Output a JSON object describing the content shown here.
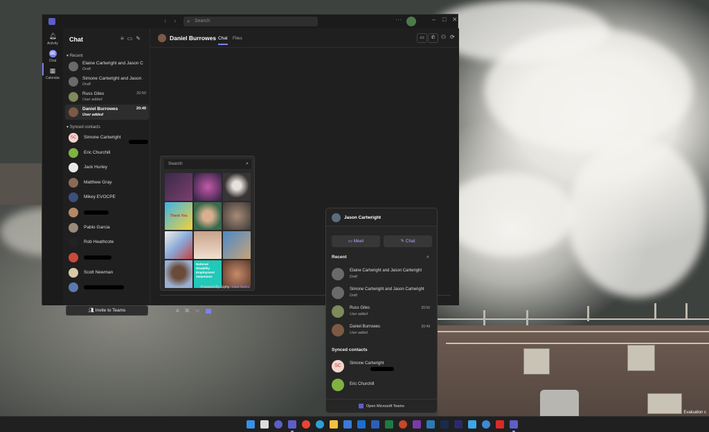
{
  "titlebar": {
    "search_placeholder": "Search",
    "more_icon": "ellipsis-icon"
  },
  "rail": {
    "items": [
      {
        "label": "Activity",
        "icon": "bell-icon"
      },
      {
        "label": "Chat",
        "icon": "chat-icon"
      },
      {
        "label": "Calendar",
        "icon": "calendar-icon"
      }
    ],
    "accent": "#7b83eb"
  },
  "chat_list": {
    "title": "Chat",
    "recent_label": "Recent",
    "recent": [
      {
        "name": "Elaine Cartwright and Jason C...",
        "sub": "Draft",
        "time": ""
      },
      {
        "name": "Simone Cartwright and Jason ...",
        "sub": "Draft",
        "time": ""
      },
      {
        "name": "Russ Giles",
        "sub": "User added",
        "time": "20:50"
      },
      {
        "name": "Daniel Burrowes",
        "sub": "User added",
        "time": "20:49"
      }
    ],
    "synced_label": "Synced contacts",
    "contacts": [
      {
        "name": "Simone Cartwright",
        "initials": "SC"
      },
      {
        "name": "Eric Churchill",
        "initials": ""
      },
      {
        "name": "Jack Hurley",
        "initials": ""
      },
      {
        "name": "Matthew Gray",
        "initials": ""
      },
      {
        "name": "Mikey EVOCPE",
        "initials": ""
      },
      {
        "name": "",
        "initials": ""
      },
      {
        "name": "Pablo Garcia",
        "initials": ""
      },
      {
        "name": "Rob Heathcote",
        "initials": ""
      },
      {
        "name": "",
        "initials": ""
      },
      {
        "name": "Scott Newman",
        "initials": ""
      },
      {
        "name": "",
        "initials": ""
      }
    ],
    "invite_label": "Invite to Teams"
  },
  "conversation": {
    "name": "Daniel Burrowes",
    "tabs": [
      "Chat",
      "Files"
    ]
  },
  "giphy": {
    "search_placeholder": "Search",
    "footer": "Powered By Giphy",
    "footer_link": "View Terms",
    "sticker_text_1": "Thank You",
    "sticker_text_2": "National Disability Employment Awareness"
  },
  "flyout": {
    "contact_name": "Jason Cartwright",
    "meet_label": "Meet",
    "chat_label": "Chat",
    "recent_label": "Recent",
    "recent": [
      {
        "name": "Elaine Cartwright and Jason Cartwright",
        "sub": "Draft",
        "time": ""
      },
      {
        "name": "Simone Cartwright and Jason Cartwright",
        "sub": "Draft",
        "time": ""
      },
      {
        "name": "Russ Giles",
        "sub": "User added",
        "time": "20:50"
      },
      {
        "name": "Daniel Burrowes",
        "sub": "User added",
        "time": "20:49"
      }
    ],
    "synced_label": "Synced contacts",
    "contacts": [
      {
        "name": "Simone Cartwright",
        "initials": "SC"
      },
      {
        "name": "Eric Churchill",
        "initials": ""
      }
    ],
    "open_label": "Open Microsoft Teams"
  },
  "desktop": {
    "watermark": "Evaluation c"
  }
}
